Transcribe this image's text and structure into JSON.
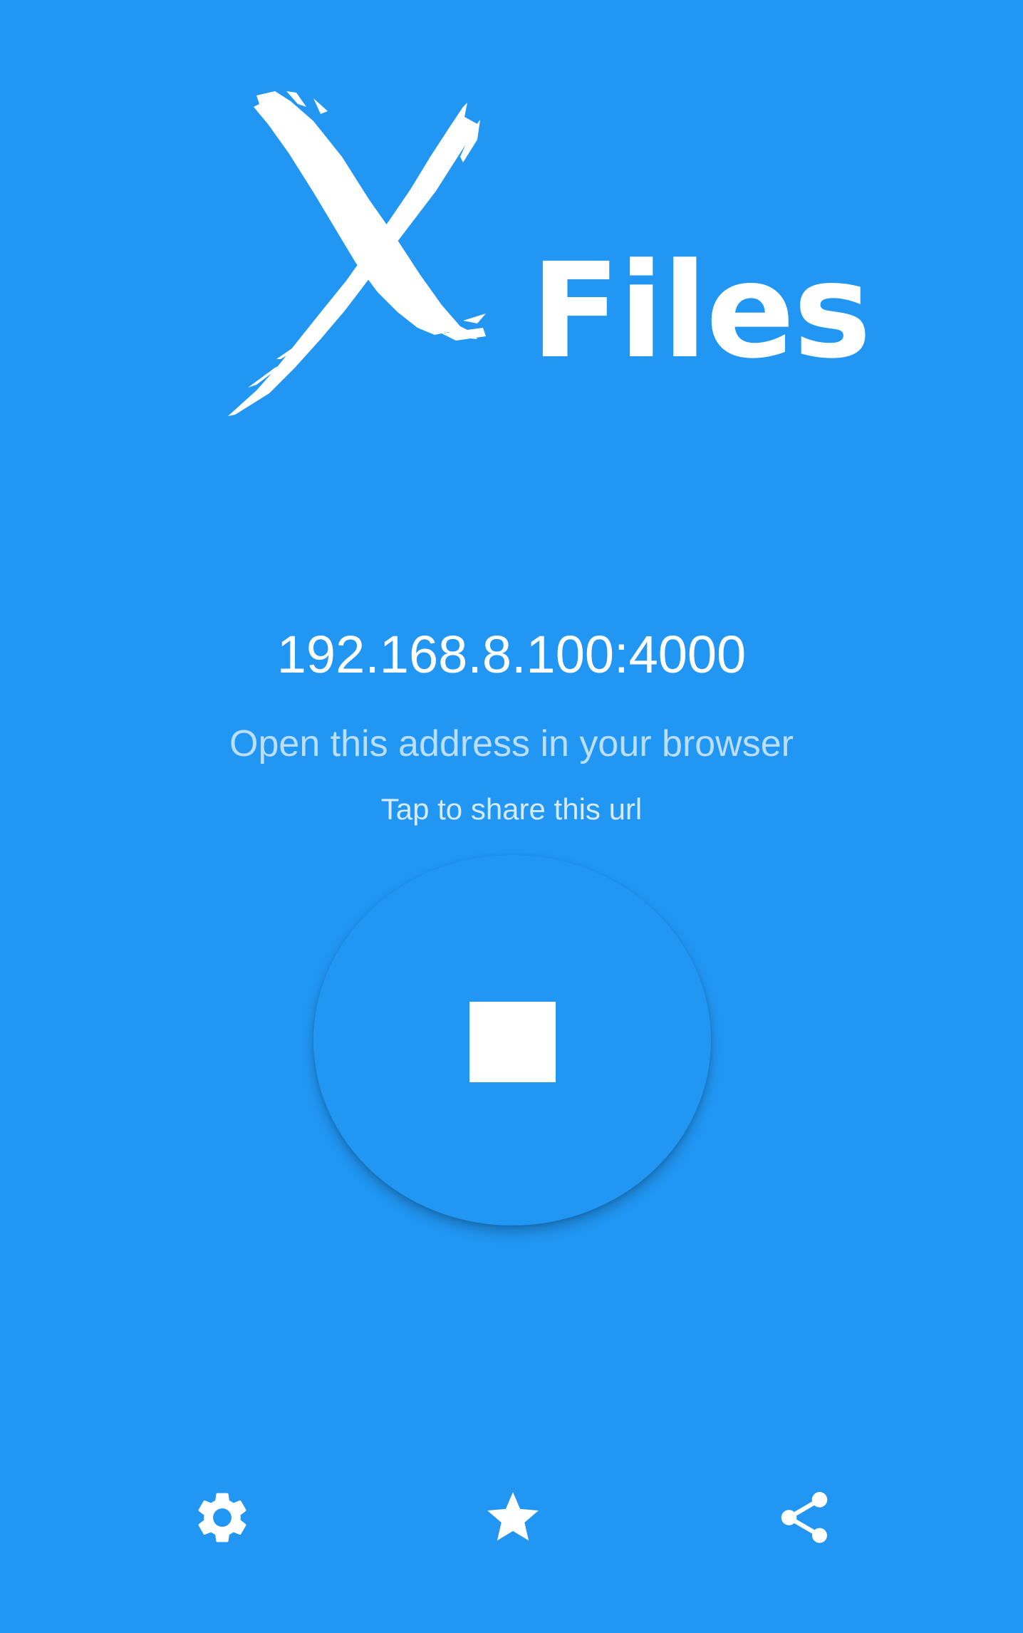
{
  "app": {
    "logo_text": "Files",
    "logo_mark": "brush-x-icon"
  },
  "server": {
    "address": "192.168.8.100:4000",
    "hint": "Open this address in your browser",
    "share_hint": "Tap to share this url"
  },
  "controls": {
    "main_button_icon": "stop-icon"
  },
  "bottom_bar": {
    "items": [
      {
        "icon": "gear-icon"
      },
      {
        "icon": "star-icon"
      },
      {
        "icon": "share-icon"
      }
    ]
  },
  "colors": {
    "background": "#2196F3",
    "foreground": "#FFFFFF",
    "secondary_text": "#BBDEFB"
  }
}
